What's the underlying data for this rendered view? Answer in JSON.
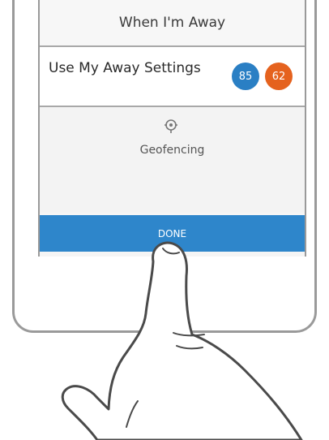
{
  "header": {
    "title": "When I'm Away"
  },
  "away_settings": {
    "label": "Use My Away Settings",
    "cool_setpoint": "85",
    "heat_setpoint": "62"
  },
  "geofencing": {
    "label": "Geofencing",
    "icon": "geofence-pin-icon"
  },
  "done_button": {
    "label": "DONE"
  },
  "colors": {
    "cool": "#2a7fc4",
    "heat": "#e5621e",
    "done": "#2e86cb"
  }
}
